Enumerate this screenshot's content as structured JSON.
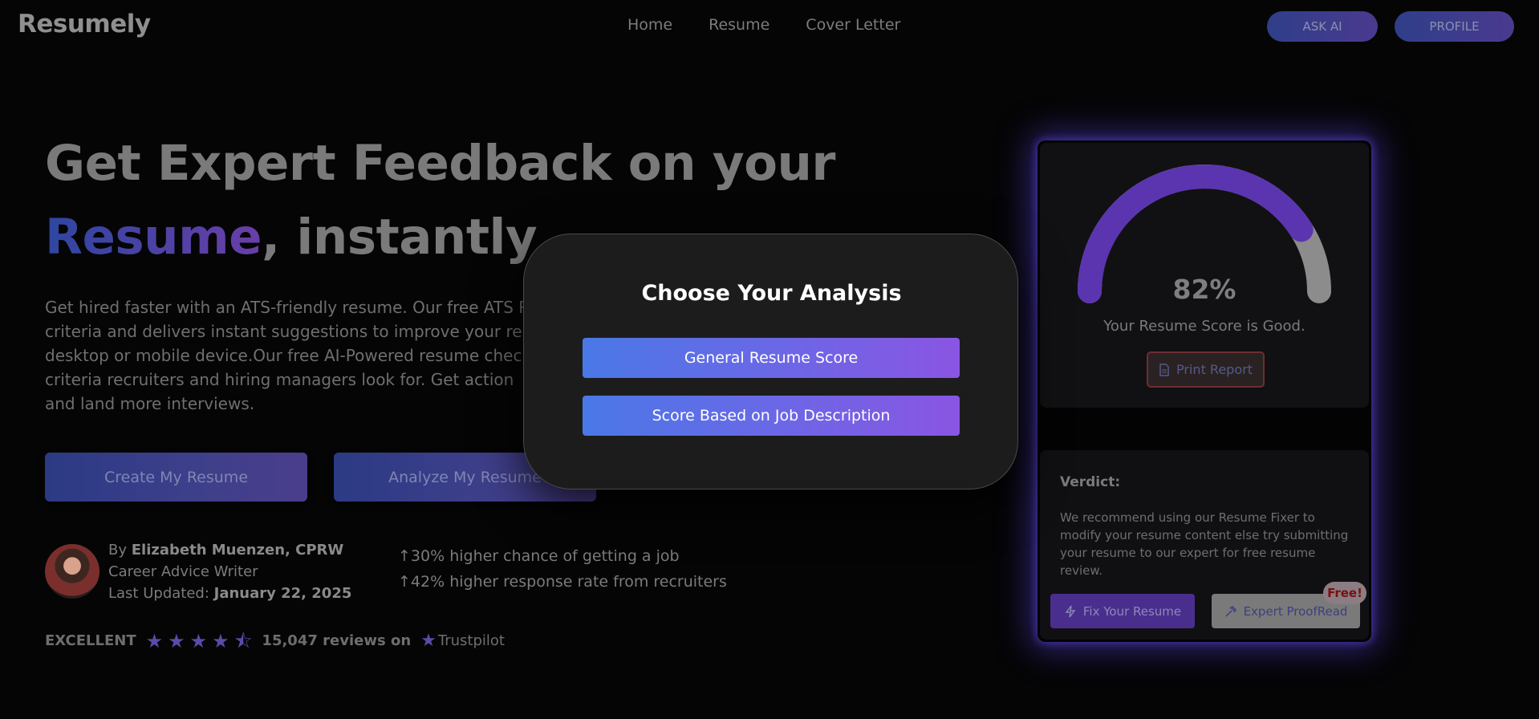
{
  "nav": {
    "logo": "Resumely",
    "links": [
      "Home",
      "Resume",
      "Cover Letter"
    ],
    "ask_ai": "ASK AI",
    "profile": "PROFILE"
  },
  "hero": {
    "title_line1": "Get Expert Feedback on your",
    "title_accent": "Resume",
    "title_rest": ", instantly",
    "description": "Get hired faster with an ATS-friendly resume. Our free ATS R criteria and delivers instant suggestions to improve your re desktop or mobile device.Our free AI-Powered resume chec criteria recruiters and hiring managers look for. Get action and land more interviews.",
    "create_button": "Create My Resume",
    "analyze_button": "Analyze My Resume"
  },
  "author": {
    "by": "By ",
    "name": "Elizabeth Muenzen, CPRW",
    "role": "Career Advice Writer",
    "updated_label": "Last Updated: ",
    "updated_date": "January 22, 2025"
  },
  "stats": [
    "30% higher chance of getting a job",
    "42% higher response rate from recruiters"
  ],
  "rating": {
    "label": "EXCELLENT",
    "stars": 4.5,
    "reviews": "15,047 reviews on",
    "platform": "Trustpilot"
  },
  "score_card": {
    "score": "82%",
    "score_value": 0.82,
    "message": "Your Resume Score is Good.",
    "print_button": "Print Report",
    "verdict_title": "Verdict:",
    "verdict_text": "We recommend using our Resume Fixer to modify your resume content else try submitting your resume to our expert for free resume review.",
    "fix_button": "Fix Your Resume",
    "expert_button": "Expert ProofRead",
    "free_badge": "Free!",
    "colors": {
      "gauge_fill": "#5b35b0",
      "gauge_track": "#8c8c8c"
    }
  },
  "modal": {
    "title": "Choose Your Analysis",
    "option1": "General Resume Score",
    "option2": "Score Based on Job Description"
  }
}
